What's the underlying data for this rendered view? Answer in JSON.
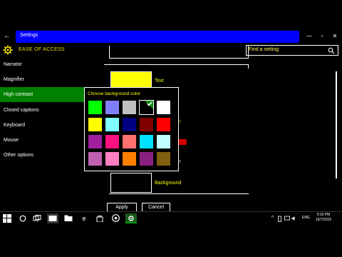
{
  "window": {
    "title": "Settings",
    "back_glyph": "←",
    "minimize_glyph": "—",
    "maximize_glyph": "▫",
    "close_glyph": "✕",
    "title_bar_color": "#0000ff"
  },
  "header": {
    "section_title": "EASE OF ACCESS",
    "search_placeholder": "Find a setting",
    "icon": "gear-icon",
    "accent_color": "#f0e000"
  },
  "sidebar": {
    "items": [
      {
        "label": "Narrator",
        "active": false
      },
      {
        "label": "Magnifier",
        "active": false
      },
      {
        "label": "High contrast",
        "active": true
      },
      {
        "label": "Closed captions",
        "active": false
      },
      {
        "label": "Keyboard",
        "active": false
      },
      {
        "label": "Mouse",
        "active": false
      },
      {
        "label": "Other options",
        "active": false
      }
    ],
    "active_color": "#008000"
  },
  "main": {
    "text_label": "Text",
    "text_swatch_color": "#ffff00",
    "background_label": "Background",
    "background_swatch_color": "#000000",
    "apply_label": "Apply",
    "cancel_label": "Cancel"
  },
  "color_picker": {
    "title": "Choose background color",
    "selected_index": 3,
    "colors": [
      "#00ff00",
      "#8080ff",
      "#c0c0c0",
      "#000000",
      "#ffffff",
      "#ffff00",
      "#80ffff",
      "#000080",
      "#800000",
      "#ff0000",
      "#a020a0",
      "#ff1080",
      "#ff7070",
      "#00e0ff",
      "#c0ffff",
      "#c060b0",
      "#ff80c0",
      "#ff8000",
      "#8a2080",
      "#806010"
    ]
  },
  "taskbar": {
    "icons": [
      "windows-icon",
      "cortana-icon",
      "task-view-icon",
      "explorer-icon",
      "edge-icon",
      "store-icon",
      "chrome-icon",
      "settings-icon"
    ],
    "language": "ENG",
    "time": "9:10 PM",
    "date": "10/7/2015"
  }
}
